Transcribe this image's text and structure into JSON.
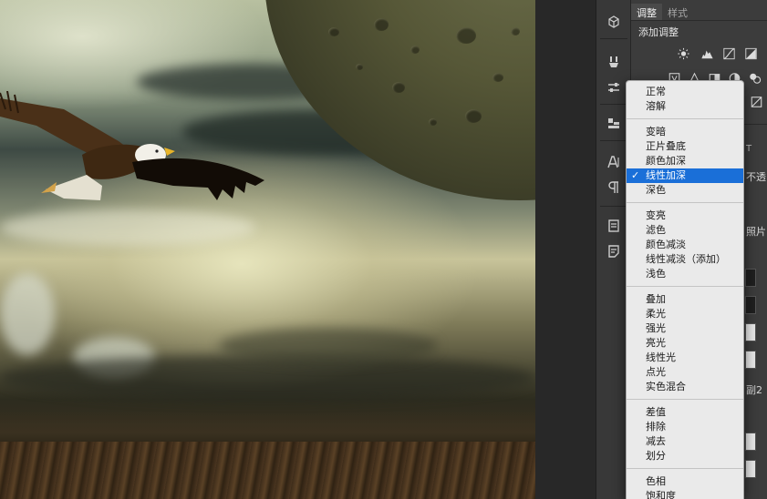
{
  "panel": {
    "tabs": [
      {
        "label": "调整",
        "active": true
      },
      {
        "label": "样式",
        "active": false
      }
    ],
    "add_adjustment": "添加调整",
    "adjustment_icons": [
      "brightness-icon",
      "levels-icon",
      "curves-icon",
      "exposure-icon"
    ],
    "adjustment_icons_row2": [
      "vibrance-icon",
      "hue-saturation-icon",
      "color-balance-icon",
      "black-white-icon",
      "photo-filter-icon"
    ],
    "fragments": {
      "opacity": "不透",
      "photo": "照片",
      "copy2": "副2"
    }
  },
  "tools": [
    "3d-icon",
    "brush-preset-icon",
    "adjust-icon",
    "layer-comps-icon",
    "character-icon",
    "paragraph-icon",
    "history-icon",
    "notes-icon"
  ],
  "blend_menu": {
    "selected": "线性加深",
    "groups": [
      [
        "正常",
        "溶解"
      ],
      [
        "变暗",
        "正片叠底",
        "颜色加深",
        "线性加深",
        "深色"
      ],
      [
        "变亮",
        "滤色",
        "颜色减淡",
        "线性减淡（添加）",
        "浅色"
      ],
      [
        "叠加",
        "柔光",
        "强光",
        "亮光",
        "线性光",
        "点光",
        "实色混合"
      ],
      [
        "差值",
        "排除",
        "减去",
        "划分"
      ],
      [
        "色相",
        "饱和度"
      ]
    ],
    "check_mark": "✓"
  },
  "colors": {
    "selection": "#1a6fd8",
    "menu_bg": "#eaeaea",
    "panel_bg": "#3c3c3c"
  }
}
